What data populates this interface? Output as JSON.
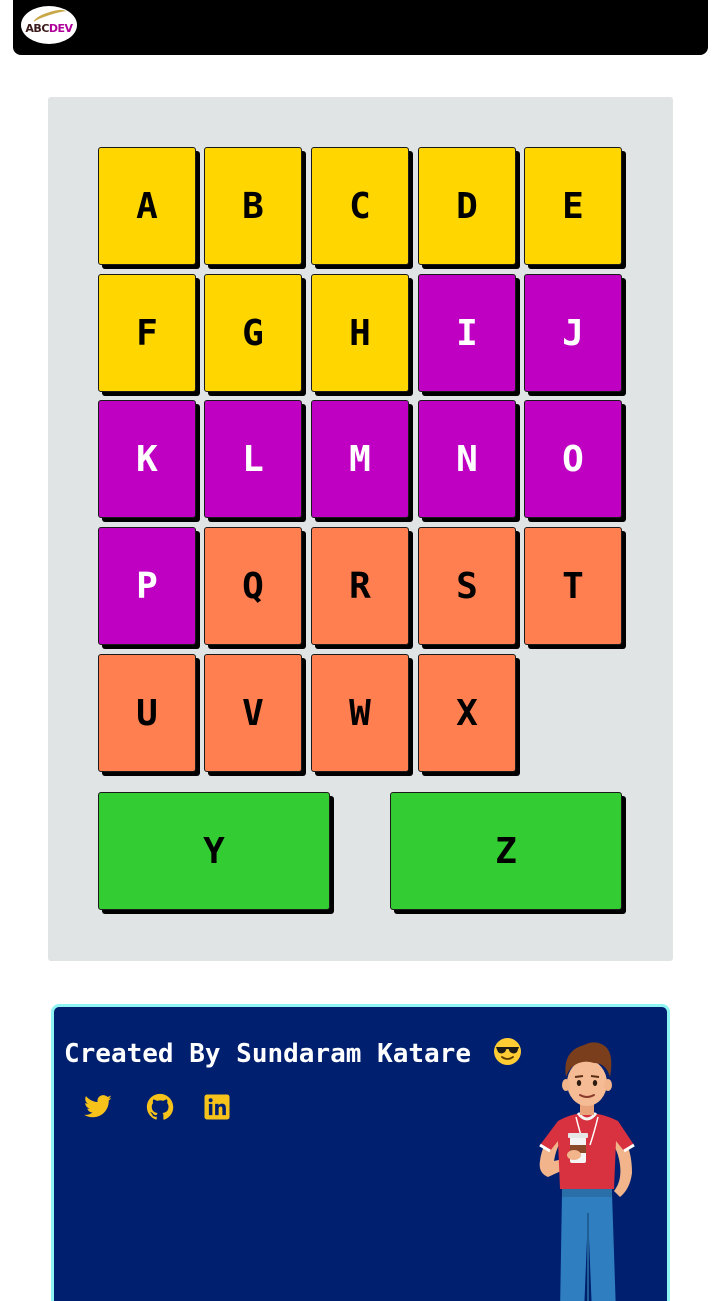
{
  "navbar": {
    "logo_text_a": "ABC",
    "logo_text_b": "DEV"
  },
  "tiles": [
    "A",
    "B",
    "C",
    "D",
    "E",
    "F",
    "G",
    "H",
    "I",
    "J",
    "K",
    "L",
    "M",
    "N",
    "O",
    "P",
    "Q",
    "R",
    "S",
    "T",
    "U",
    "V",
    "W",
    "X",
    "Y",
    "Z"
  ],
  "colors": {
    "yellow": "#ffd600",
    "magenta": "#bf00c3",
    "orange": "#ff7f50",
    "green": "#33cc33",
    "board": "#e0e4e4",
    "footer": "#001f6f",
    "footer_border": "#8ff5f2",
    "icons": "#f7c31b"
  },
  "footer": {
    "credit": "Created By Sundaram Katare",
    "emoji_icon": "sunglasses-emoji-icon",
    "social_icons": [
      "twitter-icon",
      "github-icon",
      "linkedin-icon"
    ]
  }
}
